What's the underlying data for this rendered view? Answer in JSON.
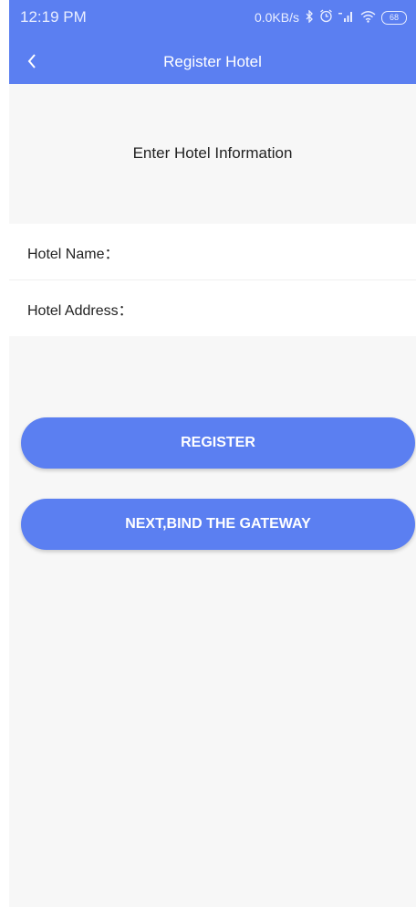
{
  "status_bar": {
    "time": "12:19 PM",
    "network_speed": "0.0KB/s",
    "battery_level": "68",
    "icons": [
      "bluetooth-icon",
      "alarm-icon",
      "signal-icon",
      "wifi-icon",
      "battery-icon"
    ]
  },
  "nav": {
    "back_icon": "chevron-left-icon",
    "title": "Register Hotel"
  },
  "section": {
    "title": "Enter Hotel Information"
  },
  "form": {
    "hotel_name_label": "Hotel Name：",
    "hotel_name_value": "",
    "hotel_address_label": "Hotel Address：",
    "hotel_address_value": ""
  },
  "buttons": {
    "register_label": "REGISTER",
    "next_label": "NEXT,BIND THE GATEWAY"
  },
  "colors": {
    "primary": "#5b7ff1",
    "background": "#f7f7f7",
    "surface": "#ffffff"
  }
}
